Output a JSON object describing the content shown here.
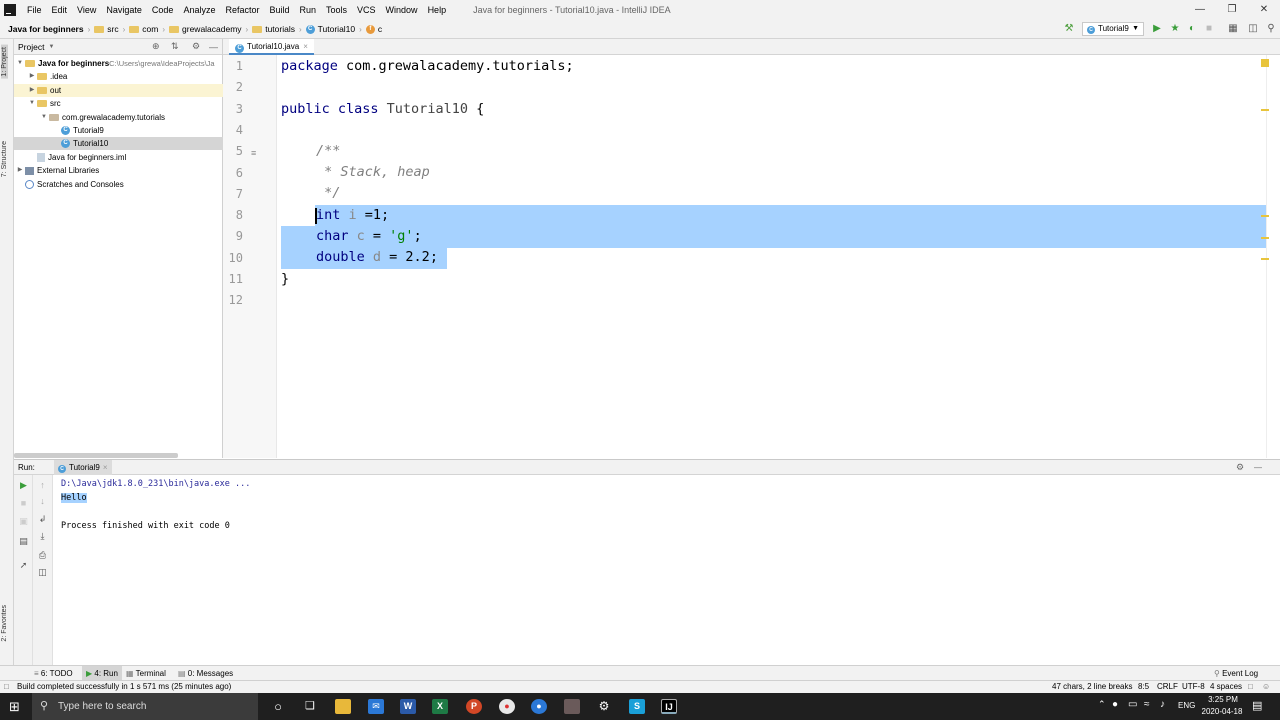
{
  "menubar": {
    "items": [
      "File",
      "Edit",
      "View",
      "Navigate",
      "Code",
      "Analyze",
      "Refactor",
      "Build",
      "Run",
      "Tools",
      "VCS",
      "Window",
      "Help"
    ],
    "window_title": "Java for beginners - Tutorial10.java - IntelliJ IDEA"
  },
  "navbar": {
    "crumbs": [
      "Java for beginners",
      "src",
      "com",
      "grewalacademy",
      "tutorials",
      "Tutorial10",
      "c"
    ],
    "run_config": "Tutorial9"
  },
  "project_panel": {
    "title": "Project",
    "tree": [
      {
        "label": "Java for beginners",
        "path": "C:\\Users\\grewa\\IdeaProjects\\Ja",
        "indent": 0,
        "arrow": "▼",
        "icon": "folder",
        "bold": true
      },
      {
        "label": ".idea",
        "indent": 1,
        "arrow": "▶",
        "icon": "folder"
      },
      {
        "label": "out",
        "indent": 1,
        "arrow": "▶",
        "icon": "folder"
      },
      {
        "label": "src",
        "indent": 1,
        "arrow": "▼",
        "icon": "folder"
      },
      {
        "label": "com.grewalacademy.tutorials",
        "indent": 2,
        "arrow": "▼",
        "icon": "package"
      },
      {
        "label": "Tutorial9",
        "indent": 3,
        "arrow": "",
        "icon": "class"
      },
      {
        "label": "Tutorial10",
        "indent": 3,
        "arrow": "",
        "icon": "class"
      },
      {
        "label": "Java for beginners.iml",
        "indent": 1,
        "arrow": "",
        "icon": "file"
      },
      {
        "label": "External Libraries",
        "indent": 0,
        "arrow": "▶",
        "icon": "lib"
      },
      {
        "label": "Scratches and Consoles",
        "indent": 0,
        "arrow": "",
        "icon": "scratch"
      }
    ]
  },
  "editor": {
    "tab_label": "Tutorial10.java",
    "line_numbers": [
      "1",
      "2",
      "3",
      "4",
      "5",
      "6",
      "7",
      "8",
      "9",
      "10",
      "11",
      "12"
    ],
    "code": {
      "l1_kw": "package",
      "l1_rest": " com.grewalacademy.tutorials;",
      "l3_kw": "public class",
      "l3_name": " Tutorial10",
      "l3_rest": " {",
      "l5": "/**",
      "l6": " * Stack, heap",
      "l7": " */",
      "l8_kw": "int",
      "l8_var": " i",
      "l8_rest": " =1;",
      "l9_kw": "char",
      "l9_var": " c",
      "l9_eq": " = ",
      "l9_str": "'g'",
      "l9_end": ";",
      "l10_kw": "double",
      "l10_var": " d",
      "l10_rest": " = 2.2;",
      "l11": "}"
    }
  },
  "run_panel": {
    "label": "Run:",
    "tab": "Tutorial9",
    "console": [
      "D:\\Java\\jdk1.8.0_231\\bin\\java.exe ...",
      "Hello",
      "",
      "Process finished with exit code 0"
    ]
  },
  "bottom_tabs": [
    "6: TODO",
    "4: Run",
    "Terminal",
    "0: Messages"
  ],
  "event_log": "Event Log",
  "status": {
    "message": "Build completed successfully in 1 s 571 ms (25 minutes ago)",
    "selection": "47 chars, 2 line breaks",
    "position": "8:5",
    "line_sep": "CRLF",
    "encoding": "UTF-8",
    "indent": "4 spaces"
  },
  "taskbar": {
    "search_placeholder": "Type here to search",
    "lang": "ENG",
    "time": "3:25 PM",
    "date": "2020-04-18"
  },
  "side_tabs": {
    "project": "1: Project",
    "structure": "7: Structure",
    "favorites": "2: Favorites"
  }
}
